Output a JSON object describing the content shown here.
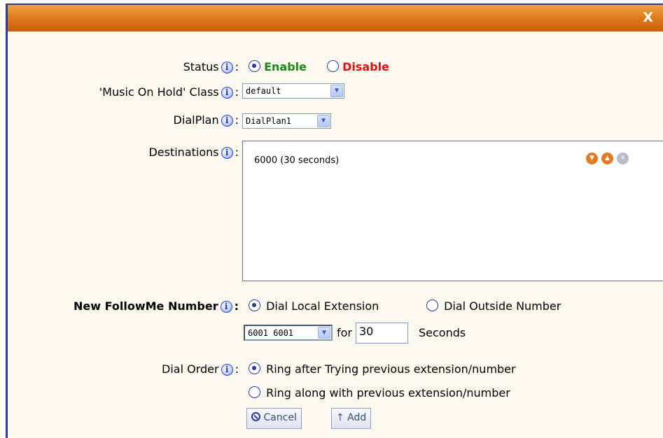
{
  "dialog": {
    "close_label": "X"
  },
  "status": {
    "label": "Status",
    "enable": "Enable",
    "disable": "Disable"
  },
  "moh": {
    "label": "'Music On Hold' Class",
    "value": "default"
  },
  "dialplan": {
    "label": "DialPlan",
    "value": "DialPlan1"
  },
  "destinations": {
    "label": "Destinations",
    "items": [
      {
        "text": "6000 (30 seconds)"
      }
    ]
  },
  "followme": {
    "label": "New FollowMe Number",
    "option_local": "Dial Local Extension",
    "option_outside": "Dial Outside Number",
    "extension_value": "6001 6001",
    "for_label": "for",
    "seconds_value": "30",
    "seconds_label": "Seconds"
  },
  "dial_order": {
    "label": "Dial Order",
    "option_after": "Ring after Trying previous extension/number",
    "option_along": "Ring along with previous extension/number"
  },
  "buttons": {
    "cancel": "Cancel",
    "add": "↑ Add"
  },
  "colors": {
    "title_bar": "#de7a1c",
    "enable": "#1a8a14",
    "disable": "#e01010"
  }
}
